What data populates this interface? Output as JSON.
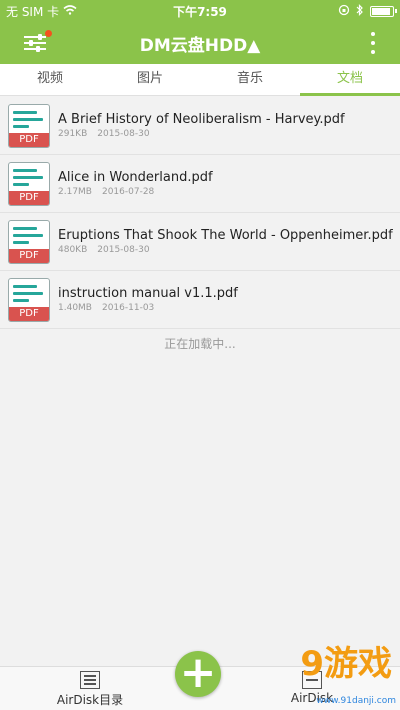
{
  "status_bar": {
    "carrier": "无 SIM 卡",
    "time": "下午7:59"
  },
  "nav": {
    "title": "DM云盘HDD▲"
  },
  "tabs": [
    {
      "label": "视频"
    },
    {
      "label": "图片"
    },
    {
      "label": "音乐"
    },
    {
      "label": "文档"
    }
  ],
  "files": [
    {
      "icon_label": "PDF",
      "name": "A Brief History of Neoliberalism - Harvey.pdf",
      "size": "291KB",
      "date": "2015-08-30"
    },
    {
      "icon_label": "PDF",
      "name": "Alice in Wonderland.pdf",
      "size": "2.17MB",
      "date": "2016-07-28"
    },
    {
      "icon_label": "PDF",
      "name": "Eruptions That Shook The World - Oppenheimer.pdf",
      "size": "480KB",
      "date": "2015-08-30"
    },
    {
      "icon_label": "PDF",
      "name": "instruction manual v1.1.pdf",
      "size": "1.40MB",
      "date": "2016-11-03"
    }
  ],
  "loading_text": "正在加载中...",
  "bottom_bar": {
    "left_label": "AirDisk目录",
    "right_label": "AirDisk"
  },
  "watermark": {
    "logo": "9游戏",
    "site": "www.91danji.com"
  },
  "colors": {
    "accent": "#8bc34a",
    "pdf_red": "#d9534f",
    "pdf_lines": "#26a69a"
  }
}
